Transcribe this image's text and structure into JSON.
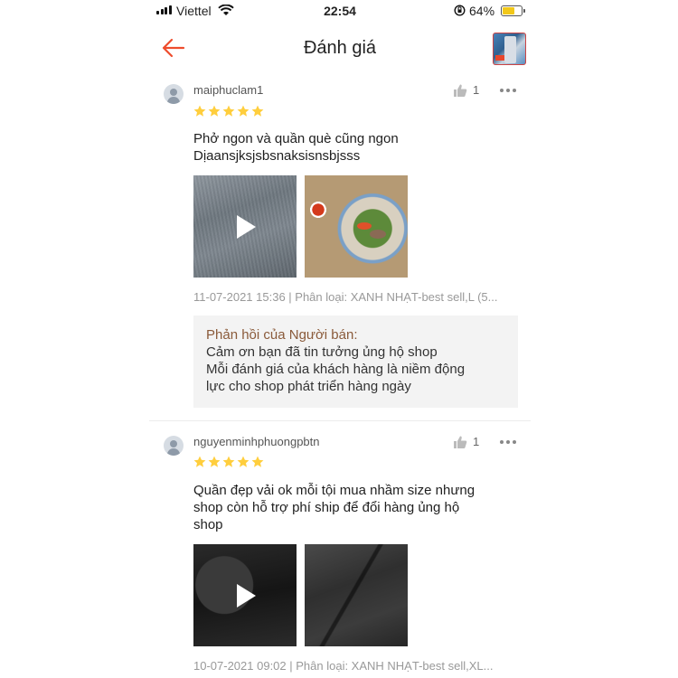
{
  "status_bar": {
    "carrier": "Viettel",
    "time": "22:54",
    "battery": "64%"
  },
  "header": {
    "title": "Đánh giá"
  },
  "reviews": [
    {
      "username": "maiphuclam1",
      "likes": "1",
      "rating": 5,
      "comment_lines": [
        "Phở ngon và quần què cũng ngon",
        "Dịaansjksjsbsnaksisnsbjsss"
      ],
      "media": [
        "video",
        "photo"
      ],
      "meta": "11-07-2021 15:36 | Phân loại: XANH NHẠT-best sell,L (5...",
      "reply": {
        "title": "Phản hồi của Người bán:",
        "lines": [
          "Cảm ơn bạn đã tin tưởng ủng hộ shop",
          "Mỗi đánh giá của khách hàng là niềm động",
          "lực cho shop phát triển hàng ngày"
        ]
      }
    },
    {
      "username": "nguyenminhphuongpbtn",
      "likes": "1",
      "rating": 5,
      "comment_lines": [
        "Quần đẹp vải ok mỗi tội mua nhầm size nhưng",
        "shop còn hỗ trợ phí ship để đổi hàng ủng hộ",
        "shop"
      ],
      "media": [
        "video",
        "photo"
      ],
      "meta": "10-07-2021 09:02 | Phân loại: XANH NHẠT-best sell,XL..."
    }
  ],
  "colors": {
    "accent": "#ee4d2d",
    "star": "#ffce3d",
    "reply_title": "#8a5a3a"
  },
  "icons": [
    "back-arrow-icon",
    "thumbs-up-icon",
    "more-options-icon",
    "play-icon",
    "star-icon",
    "user-avatar-icon",
    "wifi-icon",
    "signal-icon",
    "battery-icon"
  ]
}
